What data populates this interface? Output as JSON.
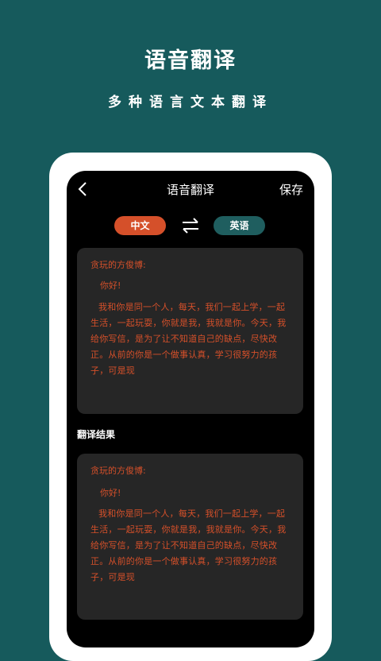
{
  "promo": {
    "title": "语音翻译",
    "subtitle": "多种语言文本翻译"
  },
  "nav": {
    "title": "语音翻译",
    "save_label": "保存"
  },
  "languages": {
    "source": "中文",
    "target": "英语"
  },
  "source_card": {
    "salutation": "贪玩的方俊博:",
    "greeting": "你好!",
    "body": "我和你是同一个人，每天，我们一起上学，一起生活，一起玩耍，你就是我，我就是你。今天，我给你写信，是为了让不知道自己的缺点，尽快改正。从前的你是一个做事认真，学习很努力的孩子，可是现"
  },
  "result": {
    "label": "翻译结果",
    "salutation": "贪玩的方俊博:",
    "greeting": "你好!",
    "body": "我和你是同一个人，每天，我们一起上学，一起生活，一起玩耍，你就是我，我就是你。今天，我给你写信，是为了让不知道自己的缺点，尽快改正。从前的你是一个做事认真，学习很努力的孩子，可是现"
  },
  "icons": {
    "back": "chevron-left-icon",
    "swap": "swap-arrows-icon"
  },
  "colors": {
    "background": "#165a5c",
    "accent_orange": "#d5502a",
    "accent_teal": "#1f5e5f",
    "card": "#262626"
  }
}
